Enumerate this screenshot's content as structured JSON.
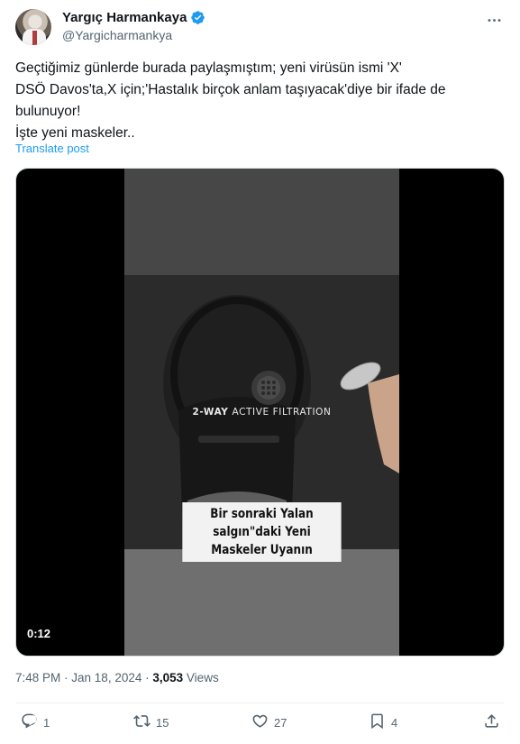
{
  "author": {
    "display_name": "Yargıç Harmankaya",
    "handle": "@Yargicharmankya"
  },
  "tweet": {
    "lines": [
      "Geçtiğimiz günlerde burada paylaşmıştım; yeni virüsün ismi 'X'",
      "DSÖ Davos'ta,X için;'Hastalık birçok anlam taşıyacak'diye bir ifade de",
      "bulunuyor!",
      "İşte yeni maskeler.."
    ],
    "translate_label": "Translate post"
  },
  "video": {
    "overlay_bold": "2-WAY",
    "overlay_rest": "ACTIVE FILTRATION",
    "caption_line1": "Bir sonraki  Yalan salgın\"daki Yeni",
    "caption_line2": "Maskeler Uyanın",
    "duration": "0:12"
  },
  "meta": {
    "time": "7:48 PM",
    "separator": " · ",
    "date": "Jan 18, 2024",
    "views_count": "3,053",
    "views_label": "Views"
  },
  "actions": {
    "replies": "1",
    "reposts": "15",
    "likes": "27",
    "bookmarks": "4"
  },
  "colors": {
    "accent": "#1d9bf0",
    "muted": "#536471",
    "text": "#0f1419"
  },
  "icons": [
    "verified-icon",
    "more-icon",
    "reply-icon",
    "repost-icon",
    "like-icon",
    "bookmark-icon",
    "share-icon"
  ]
}
